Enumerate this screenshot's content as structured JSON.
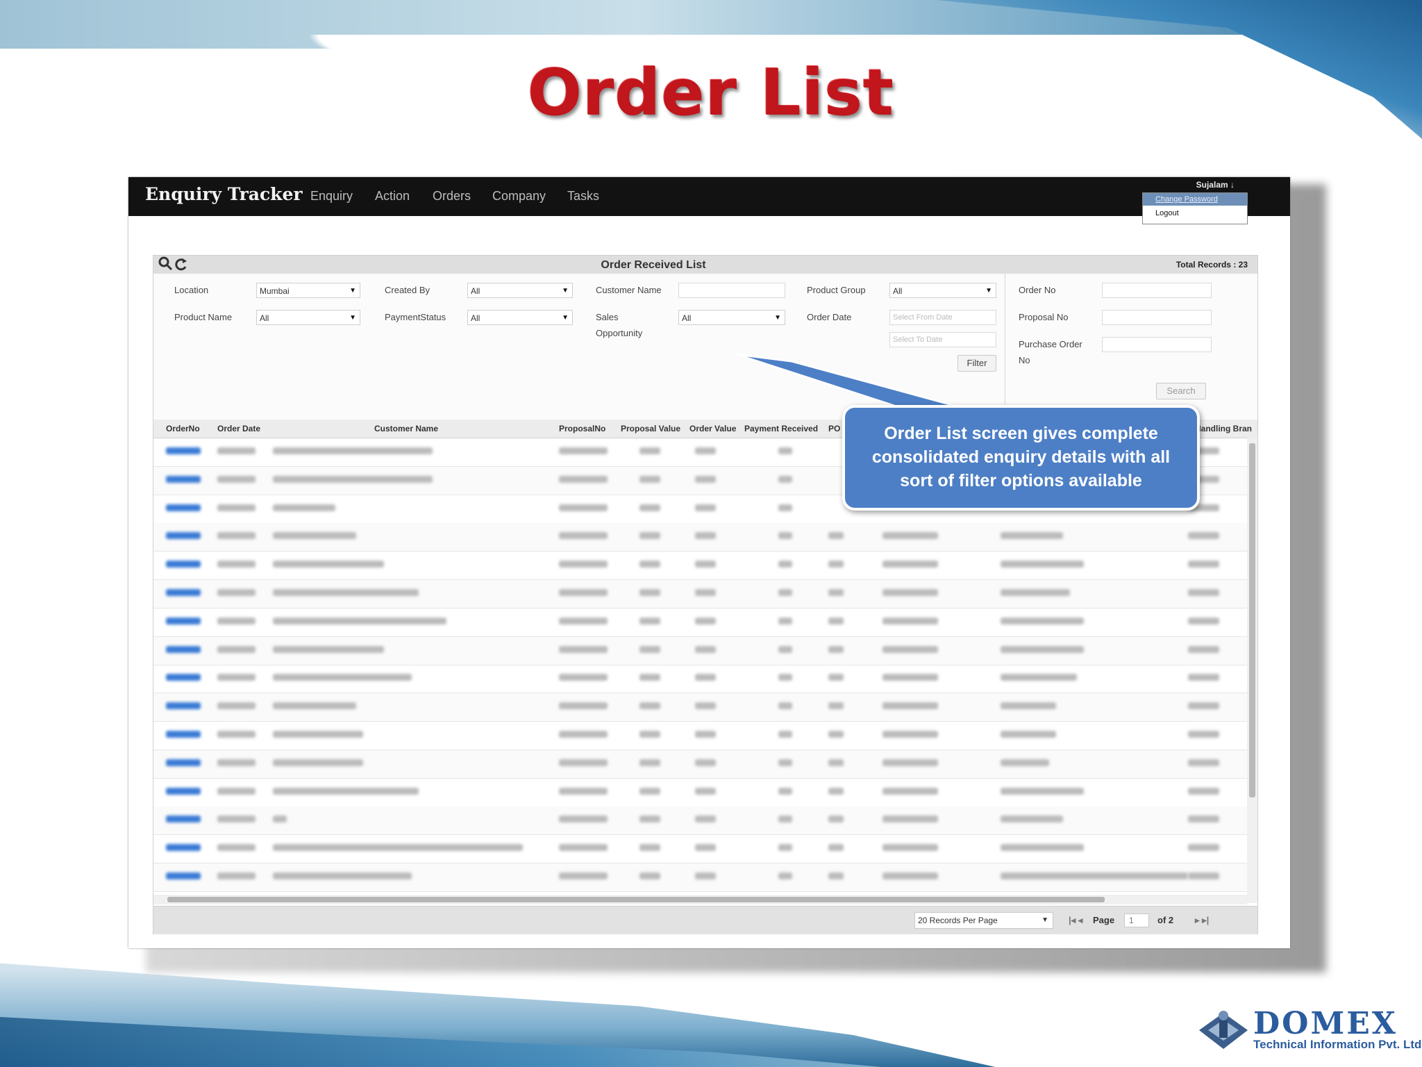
{
  "slide": {
    "title": "Order List"
  },
  "app": {
    "brand": "Enquiry Tracker",
    "nav": [
      "Enquiry",
      "Action",
      "Orders",
      "Company",
      "Tasks"
    ],
    "user": {
      "name": "Sujalam ↓",
      "change_password": "Change Password",
      "logout": "Logout"
    }
  },
  "panel": {
    "title": "Order Received List",
    "total_records": "Total Records : 23",
    "filters": {
      "location_label": "Location",
      "location_value": "Mumbai",
      "created_by_label": "Created By",
      "created_by_value": "All",
      "customer_name_label": "Customer Name",
      "product_group_label": "Product Group",
      "product_group_value": "All",
      "order_no_label": "Order No",
      "product_name_label": "Product Name",
      "product_name_value": "All",
      "payment_status_label": "PaymentStatus",
      "payment_status_value": "All",
      "sales_opportunity_label_1": "Sales",
      "sales_opportunity_label_2": "Opportunity",
      "sales_opportunity_value": "All",
      "order_date_label": "Order Date",
      "from_date_placeholder": "Select From Date",
      "to_date_placeholder": "Select To Date",
      "proposal_no_label": "Proposal No",
      "purchase_order_label_1": "Purchase Order",
      "purchase_order_label_2": "No",
      "filter_button": "Filter",
      "search_button": "Search"
    },
    "grid_headers": {
      "order_no": "OrderNo",
      "order_date": "Order Date",
      "customer_name": "Customer Name",
      "proposal_no": "ProposalNo",
      "proposal_value": "Proposal Value",
      "order_value": "Order Value",
      "payment_received": "Payment Received",
      "po": "PO",
      "handling_branch": "Handling Bran"
    },
    "pager": {
      "per_page": "20 Records Per Page",
      "page_label": "Page",
      "page_value": "1",
      "of_label": "of 2"
    }
  },
  "callout": {
    "line1": "Order List screen gives complete",
    "line2": "consolidated enquiry details with all",
    "line3": "sort of  filter options available"
  },
  "logo": {
    "name": "DOMEX",
    "subtitle": "Technical Information Pvt. Ltd."
  },
  "colors": {
    "title_red": "#c0161c",
    "callout_blue": "#4d7fc6",
    "link_blue": "#3a7bd5",
    "nav_black": "#121212"
  }
}
